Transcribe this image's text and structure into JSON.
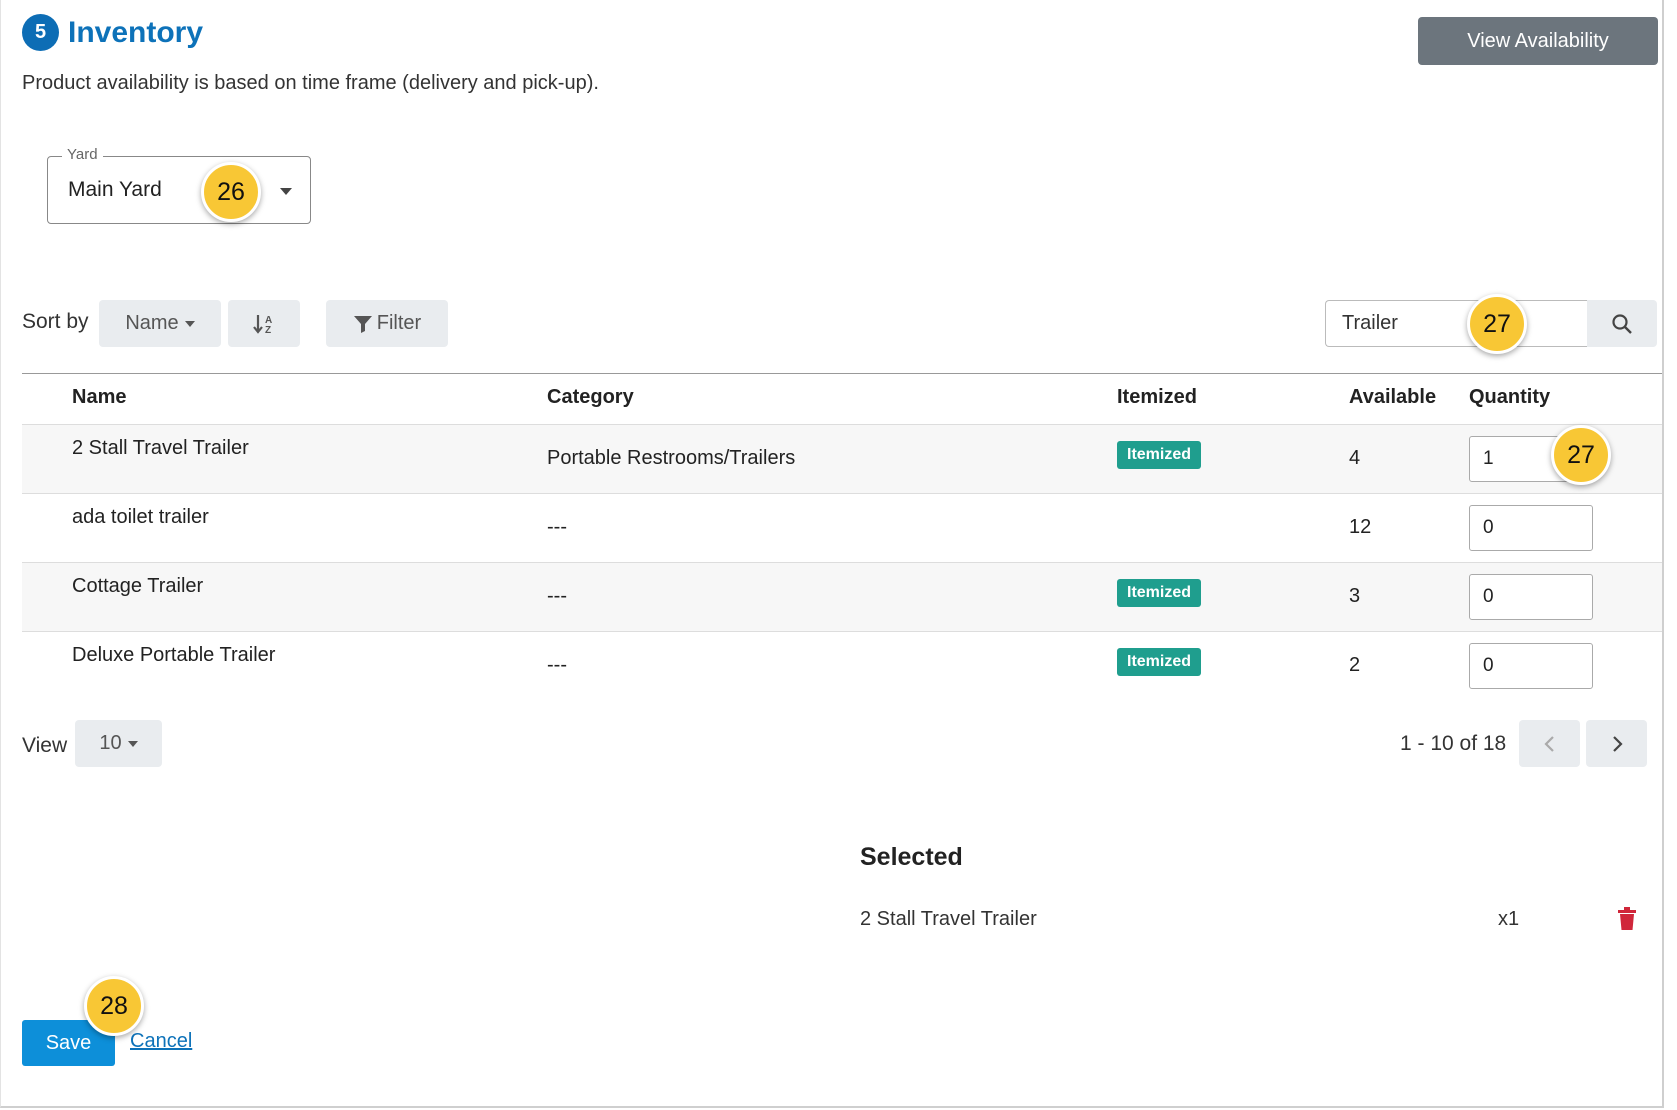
{
  "header": {
    "step_number": "5",
    "title": "Inventory",
    "subtitle": "Product availability is based on time frame (delivery and pick-up).",
    "view_availability_label": "View Availability"
  },
  "yard": {
    "label": "Yard",
    "value": "Main Yard"
  },
  "toolbar": {
    "sort_by_label": "Sort by",
    "sort_field": "Name",
    "sort_direction_icon": "sort-alpha-down-icon",
    "filter_label": "Filter",
    "search_value": "Trailer",
    "search_icon": "search-icon"
  },
  "table": {
    "headers": [
      "Name",
      "Category",
      "Itemized",
      "Available",
      "Quantity"
    ],
    "rows": [
      {
        "name": "2 Stall Travel Trailer",
        "category": "Portable Restrooms/Trailers",
        "itemized": "Itemized",
        "available": "4",
        "quantity": "1"
      },
      {
        "name": "ada toilet trailer",
        "category": "---",
        "itemized": "",
        "available": "12",
        "quantity": "0"
      },
      {
        "name": "Cottage Trailer",
        "category": "---",
        "itemized": "Itemized",
        "available": "3",
        "quantity": "0"
      },
      {
        "name": "Deluxe Portable Trailer",
        "category": "---",
        "itemized": "Itemized",
        "available": "2",
        "quantity": "0"
      }
    ]
  },
  "pagination": {
    "view_label": "View",
    "page_size": "10",
    "range_text": "1 - 10 of 18"
  },
  "selected": {
    "title": "Selected",
    "items": [
      {
        "name": "2 Stall Travel Trailer",
        "qty": "x1"
      }
    ]
  },
  "actions": {
    "save_label": "Save",
    "cancel_label": "Cancel"
  },
  "callouts": {
    "yard": "26",
    "search": "27",
    "quantity": "27",
    "save": "28"
  },
  "colors": {
    "accent": "#0d72b9",
    "itemized_badge": "#1f9e8e",
    "callout": "#f8c735",
    "save_button": "#0d8fd9",
    "delete_icon": "#d0263a"
  }
}
